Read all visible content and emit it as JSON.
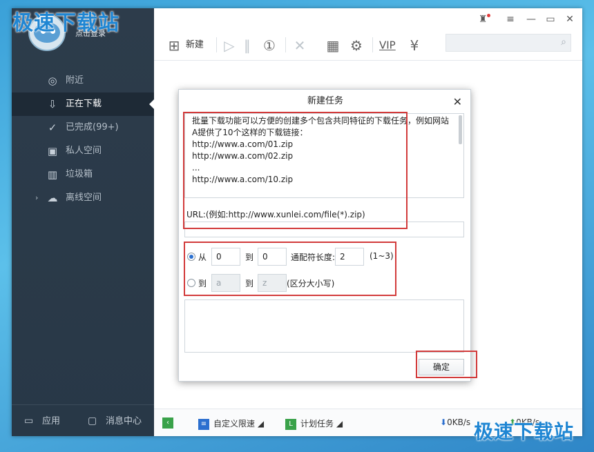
{
  "watermark": "极速下载站",
  "sidebar": {
    "login": "点击登录",
    "items": [
      {
        "label": "附近",
        "icon": "location-icon"
      },
      {
        "label": "正在下载",
        "icon": "download-icon"
      },
      {
        "label": "已完成(99+)",
        "icon": "check-circle-icon"
      },
      {
        "label": "私人空间",
        "icon": "lock-icon"
      },
      {
        "label": "垃圾箱",
        "icon": "trash-icon"
      },
      {
        "label": "离线空间",
        "icon": "cloud-icon"
      }
    ],
    "apps": "应用",
    "messages": "消息中心"
  },
  "toolbar": {
    "new": "新建",
    "vip": "VIP"
  },
  "status": {
    "speed_limit": "自定义限速",
    "schedule": "计划任务",
    "down_speed": "0KB/s",
    "up_speed": "0KB/s"
  },
  "dialog": {
    "title": "新建任务",
    "description": [
      "批量下载功能可以方便的创建多个包含共同特征的下载任务，例如网站",
      "A提供了10个这样的下载链接：",
      "http://www.a.com/01.zip",
      "http://www.a.com/02.zip",
      "...",
      "http://www.a.com/10.zip"
    ],
    "url_label": "URL:(例如:http://www.xunlei.com/file(*).zip)",
    "from_label": "从",
    "from_value": "0",
    "to_label": "到",
    "to_value": "0",
    "wildcard_label": "通配符长度:",
    "wildcard_value": "2",
    "wildcard_range": "(1~3)",
    "alpha_from_label": "到",
    "alpha_from_value": "a",
    "alpha_to_label": "到",
    "alpha_to_value": "z",
    "case_note": "(区分大小写)",
    "ok": "确定"
  },
  "colors": {
    "sidebar_bg": "#2d3c4b",
    "highlight": "#d23a3a",
    "accent": "#2b6fcf"
  }
}
